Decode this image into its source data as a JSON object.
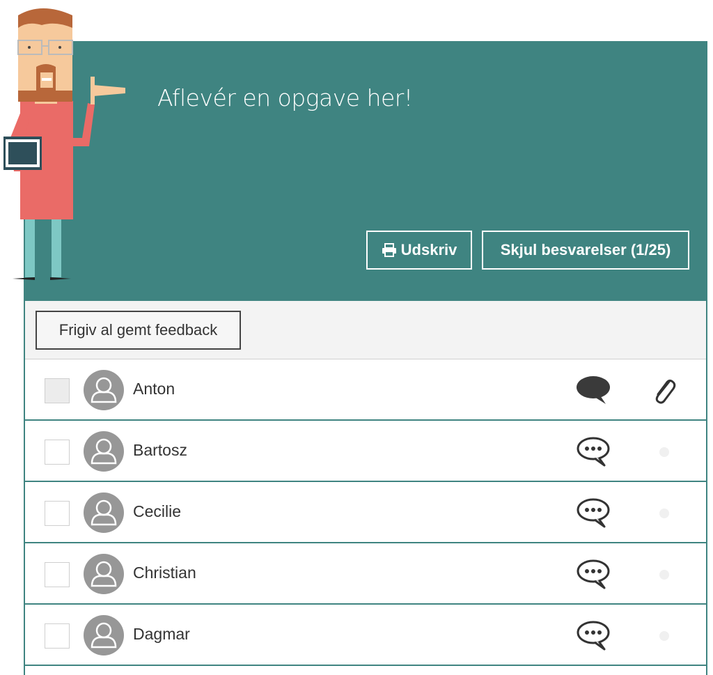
{
  "header": {
    "title": "Aflevér en opgave her!",
    "print_label": "Udskriv",
    "hide_label": "Skjul besvarelser (1/25)",
    "bg_color": "#3f8481"
  },
  "toolbar": {
    "release_label": "Frigiv al gemt feedback"
  },
  "students": [
    {
      "name": "Anton",
      "checkbox_disabled": true,
      "comment_state": "filled",
      "has_attachment": true
    },
    {
      "name": "Bartosz",
      "checkbox_disabled": false,
      "comment_state": "empty",
      "has_attachment": false
    },
    {
      "name": "Cecilie",
      "checkbox_disabled": false,
      "comment_state": "empty",
      "has_attachment": false
    },
    {
      "name": "Christian",
      "checkbox_disabled": false,
      "comment_state": "empty",
      "has_attachment": false
    },
    {
      "name": "Dagmar",
      "checkbox_disabled": false,
      "comment_state": "empty",
      "has_attachment": false
    }
  ],
  "icons": {
    "print": "printer-icon",
    "avatar": "user-icon",
    "comment_filled": "comment-filled-icon",
    "comment_empty": "comment-dots-icon",
    "attachment": "paperclip-icon"
  }
}
